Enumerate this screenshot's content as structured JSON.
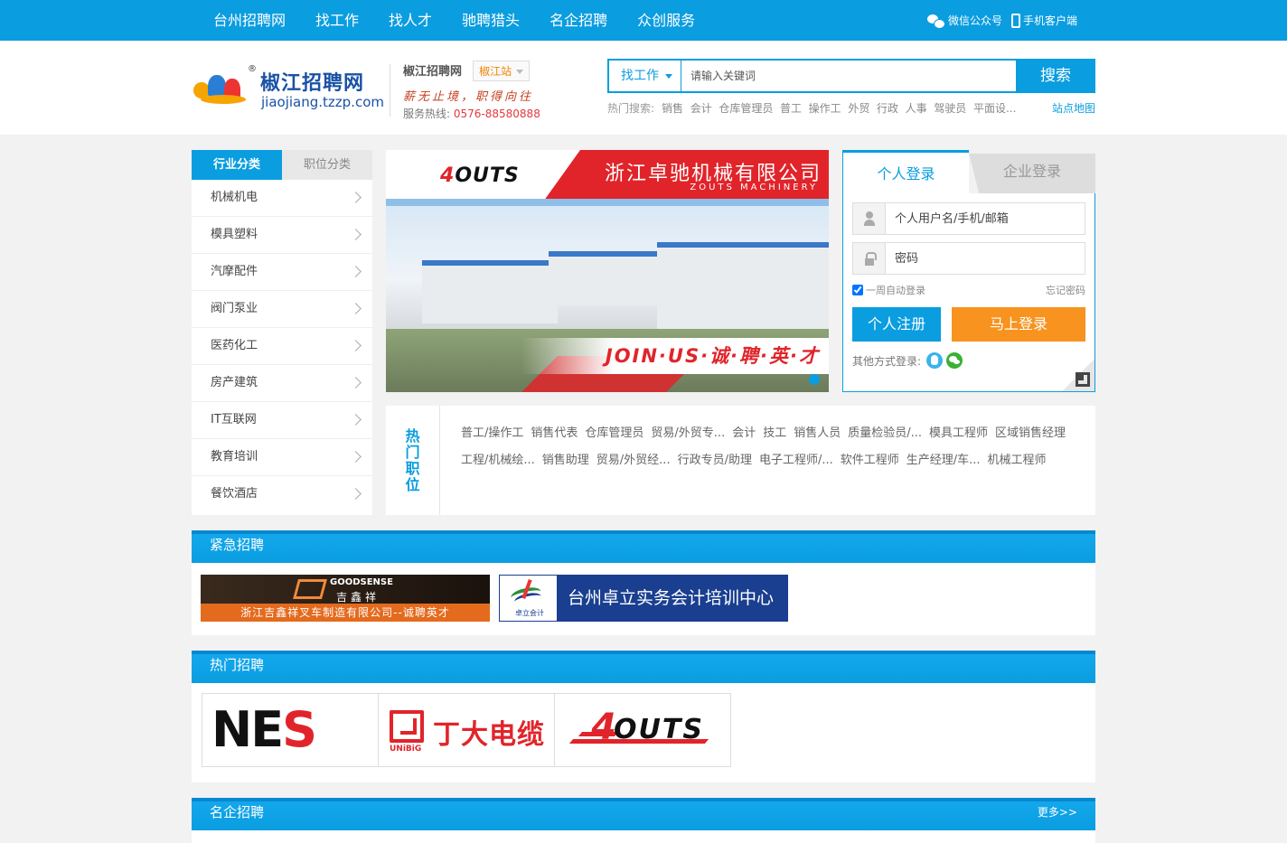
{
  "nav": {
    "items": [
      "台州招聘网",
      "找工作",
      "找人才",
      "驰聘猎头",
      "名企招聘",
      "众创服务"
    ],
    "wechat": "微信公众号",
    "mobile": "手机客户端"
  },
  "header": {
    "logo_name": "椒江招聘网",
    "logo_url": "jiaojiang.tzzp.com",
    "logo_reg": "®",
    "city_name": "椒江招聘网",
    "station": "椒江站",
    "slogan": "薪无止境，职得向往",
    "hotline_label": "服务热线:",
    "hotline": "0576-88580888"
  },
  "search": {
    "type": "找工作",
    "placeholder": "请输入关键词",
    "button": "搜索",
    "hot_label": "热门搜索:",
    "hot_keywords": [
      "销售",
      "会计",
      "仓库管理员",
      "普工",
      "操作工",
      "外贸",
      "行政",
      "人事",
      "驾驶员",
      "平面设..."
    ],
    "sitemap": "站点地图"
  },
  "categories": {
    "tabs": [
      "行业分类",
      "职位分类"
    ],
    "items": [
      "机械机电",
      "模具塑料",
      "汽摩配件",
      "阀门泵业",
      "医药化工",
      "房产建筑",
      "IT互联网",
      "教育培训",
      "餐饮酒店"
    ]
  },
  "banner": {
    "brand": "OUTS",
    "company": "浙江卓驰机械有限公司",
    "company_en": "ZOUTS MACHINERY",
    "slogan": "JOIN·US·诚·聘·英·才"
  },
  "login": {
    "tabs": [
      "个人登录",
      "企业登录"
    ],
    "user_placeholder": "个人用户名/手机/邮箱",
    "pass_placeholder": "密码",
    "remember": "一周自动登录",
    "forgot": "忘记密码",
    "register": "个人注册",
    "submit": "马上登录",
    "other": "其他方式登录:"
  },
  "hot_jobs": {
    "title": "热门职位",
    "items": [
      "普工/操作工",
      "销售代表",
      "仓库管理员",
      "贸易/外贸专...",
      "会计",
      "技工",
      "销售人员",
      "质量检验员/...",
      "模具工程师",
      "区域销售经理",
      "工程/机械绘...",
      "销售助理",
      "贸易/外贸经...",
      "行政专员/助理",
      "电子工程师/...",
      "软件工程师",
      "生产经理/车...",
      "机械工程师"
    ]
  },
  "urgent": {
    "title": "紧急招聘",
    "ad1_brand": "GOODSENSE",
    "ad1_cn": "吉鑫祥",
    "ad1_text": "浙江吉鑫祥叉车制造有限公司--诚聘英才",
    "ad2_small": "卓立会计",
    "ad2_text": "台州卓立实务会计培训中心"
  },
  "hot_recruit": {
    "title": "热门招聘",
    "nes": "NES",
    "dd_sub": "UNiBiG",
    "dd_name": "丁大电缆",
    "zouts": "OUTS"
  },
  "brands": {
    "title": "名企招聘",
    "more": "更多>>"
  }
}
